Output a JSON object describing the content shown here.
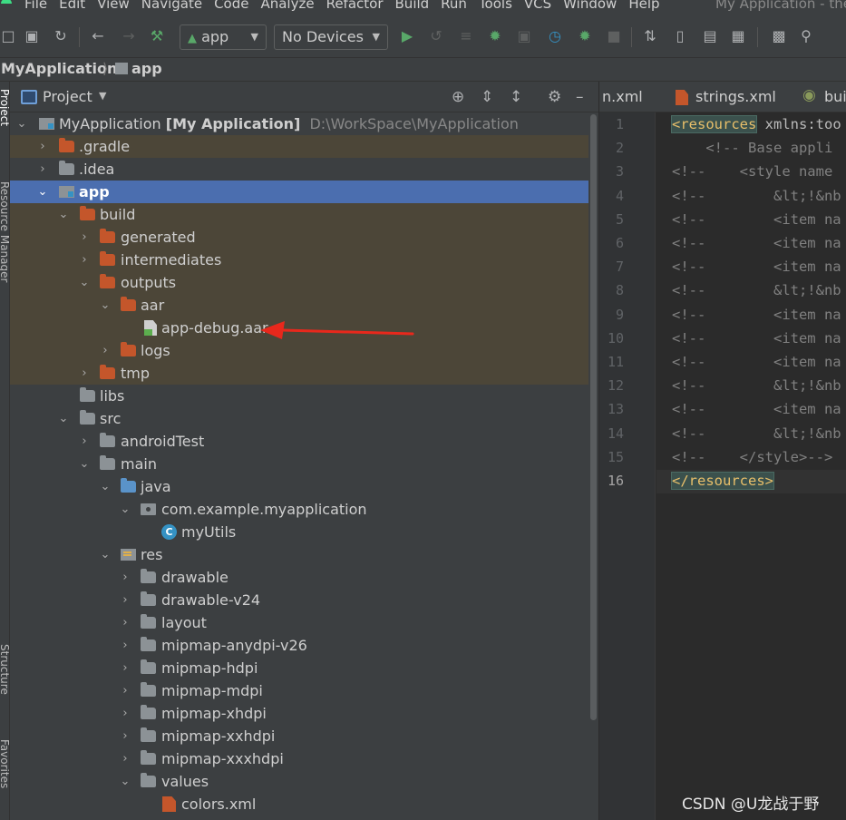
{
  "menubar": {
    "items": [
      "File",
      "Edit",
      "View",
      "Navigate",
      "Code",
      "Analyze",
      "Refactor",
      "Build",
      "Run",
      "Tools",
      "VCS",
      "Window",
      "Help"
    ],
    "window_title": "My Application - the"
  },
  "toolbar": {
    "run_config": "app",
    "device": "No Devices"
  },
  "breadcrumb": {
    "project": "MyApplication",
    "module": "app"
  },
  "left_strip": {
    "project_label": "Project",
    "resource_manager_label": "Resource Manager",
    "structure_label": "Structure",
    "favorites_label": "Favorites"
  },
  "project_panel": {
    "title": "Project"
  },
  "tree": [
    {
      "label": "MyApplication",
      "extra": "[My Application]",
      "path": "D:\\WorkSpace\\MyApplication"
    },
    {
      "label": ".gradle"
    },
    {
      "label": ".idea"
    },
    {
      "label": "app"
    },
    {
      "label": "build"
    },
    {
      "label": "generated"
    },
    {
      "label": "intermediates"
    },
    {
      "label": "outputs"
    },
    {
      "label": "aar"
    },
    {
      "label": "app-debug.aar"
    },
    {
      "label": "logs"
    },
    {
      "label": "tmp"
    },
    {
      "label": "libs"
    },
    {
      "label": "src"
    },
    {
      "label": "androidTest"
    },
    {
      "label": "main"
    },
    {
      "label": "java"
    },
    {
      "label": "com.example.myapplication"
    },
    {
      "label": "myUtils"
    },
    {
      "label": "res"
    },
    {
      "label": "drawable"
    },
    {
      "label": "drawable-v24"
    },
    {
      "label": "layout"
    },
    {
      "label": "mipmap-anydpi-v26"
    },
    {
      "label": "mipmap-hdpi"
    },
    {
      "label": "mipmap-mdpi"
    },
    {
      "label": "mipmap-xhdpi"
    },
    {
      "label": "mipmap-xxhdpi"
    },
    {
      "label": "mipmap-xxxhdpi"
    },
    {
      "label": "values"
    },
    {
      "label": "colors.xml"
    }
  ],
  "editor": {
    "tabs": [
      "n.xml",
      "strings.xml",
      "bui"
    ],
    "line_numbers": [
      "1",
      "2",
      "3",
      "4",
      "5",
      "6",
      "7",
      "8",
      "9",
      "10",
      "11",
      "12",
      "13",
      "14",
      "15",
      "16"
    ],
    "code_lines": [
      {
        "tag": "<resources",
        "rest": " xmlns:too"
      },
      {
        "text": "    <!-- Base appli"
      },
      {
        "text": "<!--    <style name"
      },
      {
        "text": "<!--        &lt;!&nb"
      },
      {
        "text": "<!--        <item na"
      },
      {
        "text": "<!--        <item na"
      },
      {
        "text": "<!--        <item na"
      },
      {
        "text": "<!--        &lt;!&nb"
      },
      {
        "text": "<!--        <item na"
      },
      {
        "text": "<!--        <item na"
      },
      {
        "text": "<!--        <item na"
      },
      {
        "text": "<!--        &lt;!&nb"
      },
      {
        "text": "<!--        <item na"
      },
      {
        "text": "<!--        &lt;!&nb"
      },
      {
        "text": "<!--    </style>-->"
      },
      {
        "tag": "</resources>",
        "rest": ""
      }
    ]
  },
  "watermark": "CSDN @U龙战于野",
  "colors": {
    "selection": "#4b6eaf",
    "excluded": "#4c4638",
    "folder_orange": "#c4562b",
    "annotation_arrow": "#e8281c"
  }
}
